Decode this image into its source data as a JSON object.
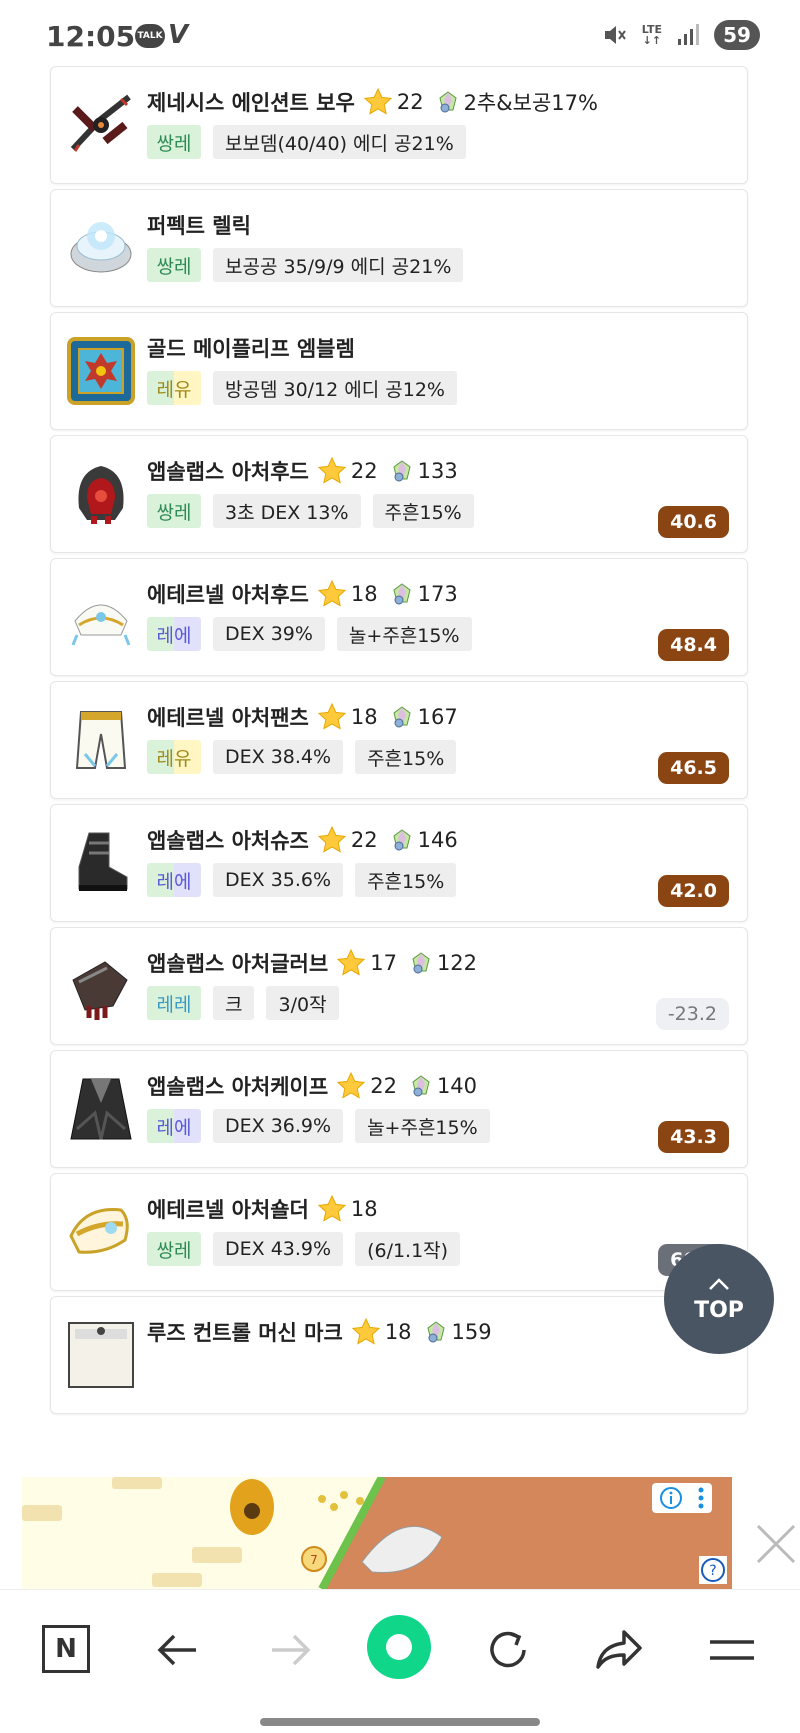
{
  "status_bar": {
    "time": "12:05",
    "talk_badge": "TALK",
    "v_icon": "V",
    "lte": "LTE",
    "battery": "59"
  },
  "items": [
    {
      "name": "제네시스 에인션트 보우",
      "star": "22",
      "gem": "2추&보공17%",
      "potential": "쌍레",
      "pot_colors": [
        "#d9f2d9"
      ],
      "pot_text_color": "#2e8b57",
      "tags": [
        "보보뎀(40/40) 에디 공21%"
      ],
      "score": "",
      "icon": "genesis-bow-icon"
    },
    {
      "name": "퍼펙트 렐릭",
      "star": "",
      "gem": "",
      "potential": "쌍레",
      "pot_colors": [
        "#d9f2d9"
      ],
      "pot_text_color": "#2e8b57",
      "tags": [
        "보공공 35/9/9 에디 공21%"
      ],
      "score": "",
      "icon": "relic-icon"
    },
    {
      "name": "골드 메이플리프 엠블렘",
      "star": "",
      "gem": "",
      "potential": "레유",
      "pot_colors": [
        "#d9f2d9",
        "#fff6c4"
      ],
      "pot_text_color": "#a08a1c",
      "tags": [
        "방공뎀 30/12 에디 공12%"
      ],
      "score": "",
      "icon": "emblem-icon"
    },
    {
      "name": "앱솔랩스 아처후드",
      "star": "22",
      "gem": "133",
      "potential": "쌍레",
      "pot_colors": [
        "#d9f2d9"
      ],
      "pot_text_color": "#2e8b57",
      "tags": [
        "3초 DEX 13%",
        "주흔15%"
      ],
      "score": "40.6",
      "score_style": "brown",
      "icon": "hood-icon"
    },
    {
      "name": "에테르넬 아처후드",
      "star": "18",
      "gem": "173",
      "potential": "레에",
      "pot_colors": [
        "#d9f2d9",
        "#e1e1fb"
      ],
      "pot_text_color": "#5b5bd6",
      "tags": [
        "DEX 39%",
        "놀+주흔15%"
      ],
      "score": "48.4",
      "score_style": "brown",
      "icon": "eternal-hood-icon"
    },
    {
      "name": "에테르넬 아처팬츠",
      "star": "18",
      "gem": "167",
      "potential": "레유",
      "pot_colors": [
        "#d9f2d9",
        "#fff6c4"
      ],
      "pot_text_color": "#a08a1c",
      "tags": [
        "DEX 38.4%",
        "주흔15%"
      ],
      "score": "46.5",
      "score_style": "brown",
      "icon": "pants-icon"
    },
    {
      "name": "앱솔랩스 아처슈즈",
      "star": "22",
      "gem": "146",
      "potential": "레에",
      "pot_colors": [
        "#d9f2d9",
        "#e1e1fb"
      ],
      "pot_text_color": "#5b5bd6",
      "tags": [
        "DEX 35.6%",
        "주흔15%"
      ],
      "score": "42.0",
      "score_style": "brown",
      "icon": "shoes-icon"
    },
    {
      "name": "앱솔랩스 아처글러브",
      "star": "17",
      "gem": "122",
      "potential": "레레",
      "pot_colors": [
        "#d9f2d9"
      ],
      "pot_text_color": "#3a9ac4",
      "tags": [
        "크",
        "3/0작"
      ],
      "score": "-23.2",
      "score_style": "neg",
      "icon": "glove-icon"
    },
    {
      "name": "앱솔랩스 아처케이프",
      "star": "22",
      "gem": "140",
      "potential": "레에",
      "pot_colors": [
        "#d9f2d9",
        "#e1e1fb"
      ],
      "pot_text_color": "#5b5bd6",
      "tags": [
        "DEX 36.9%",
        "놀+주흔15%"
      ],
      "score": "43.3",
      "score_style": "brown",
      "icon": "cape-icon"
    },
    {
      "name": "에테르넬 아처숄더",
      "star": "18",
      "gem": "",
      "potential": "쌍레",
      "pot_colors": [
        "#d9f2d9"
      ],
      "pot_text_color": "#2e8b57",
      "tags": [
        "DEX 43.9%",
        "(6/1.1작)"
      ],
      "score": "60.5",
      "score_style": "gray",
      "icon": "shoulder-icon"
    },
    {
      "name": "루즈 컨트롤 머신 마크",
      "star": "18",
      "gem": "159",
      "potential": "",
      "pot_colors": [],
      "pot_text_color": "#222",
      "tags": [],
      "score": "",
      "icon": "machine-mark-icon"
    }
  ],
  "top_button": {
    "label": "TOP"
  },
  "ad": {
    "timer_badge": "7"
  },
  "bottom_nav": {
    "home_label": "N"
  }
}
